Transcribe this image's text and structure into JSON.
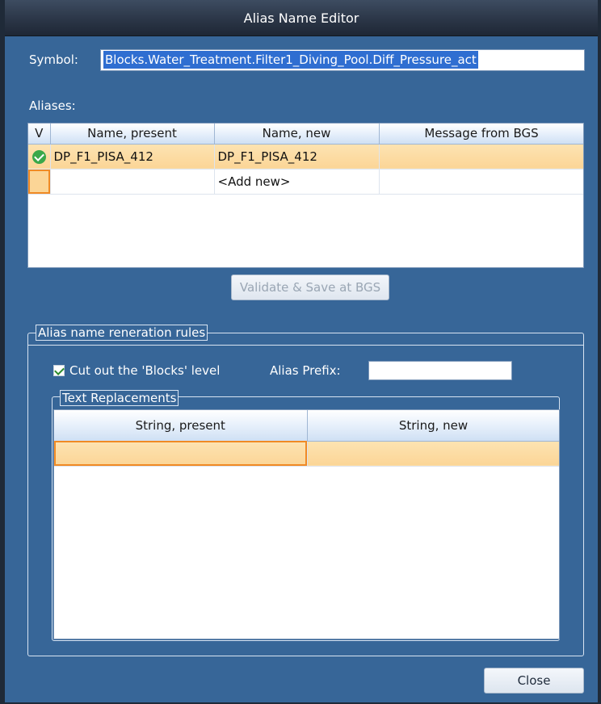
{
  "window": {
    "title": "Alias Name Editor"
  },
  "symbol": {
    "label": "Symbol:",
    "value": "Blocks.Water_Treatment.Filter1_Diving_Pool.Diff_Pressure_act"
  },
  "aliases": {
    "label": "Aliases:",
    "columns": [
      "V",
      "Name, present",
      "Name, new",
      "Message from BGS"
    ],
    "rows": [
      {
        "status": "valid",
        "name_present": "DP_F1_PISA_412",
        "name_new": "DP_F1_PISA_412",
        "message": ""
      },
      {
        "status": "",
        "name_present": "",
        "name_new": "<Add new>",
        "message": ""
      }
    ]
  },
  "validate_button": {
    "label": "Validate & Save at BGS",
    "enabled": false
  },
  "rules": {
    "title": "Alias name reneration rules",
    "cut_blocks": {
      "label": "Cut out the 'Blocks' level",
      "checked": true
    },
    "alias_prefix": {
      "label": "Alias Prefix:",
      "value": ""
    },
    "text_replacements": {
      "title": "Text Replacements",
      "columns": [
        "String, present",
        "String, new"
      ],
      "rows": [
        {
          "present": "",
          "new": ""
        }
      ]
    }
  },
  "close_button": {
    "label": "Close"
  },
  "colors": {
    "background": "#376698",
    "titlebar": "#2b3647",
    "selection_orange": "#fbd596",
    "selection_border": "#f08a24",
    "valid_green": "#3aa84a"
  },
  "icons": {
    "valid": "check-circle-icon",
    "checkbox": "checkmark-icon"
  }
}
